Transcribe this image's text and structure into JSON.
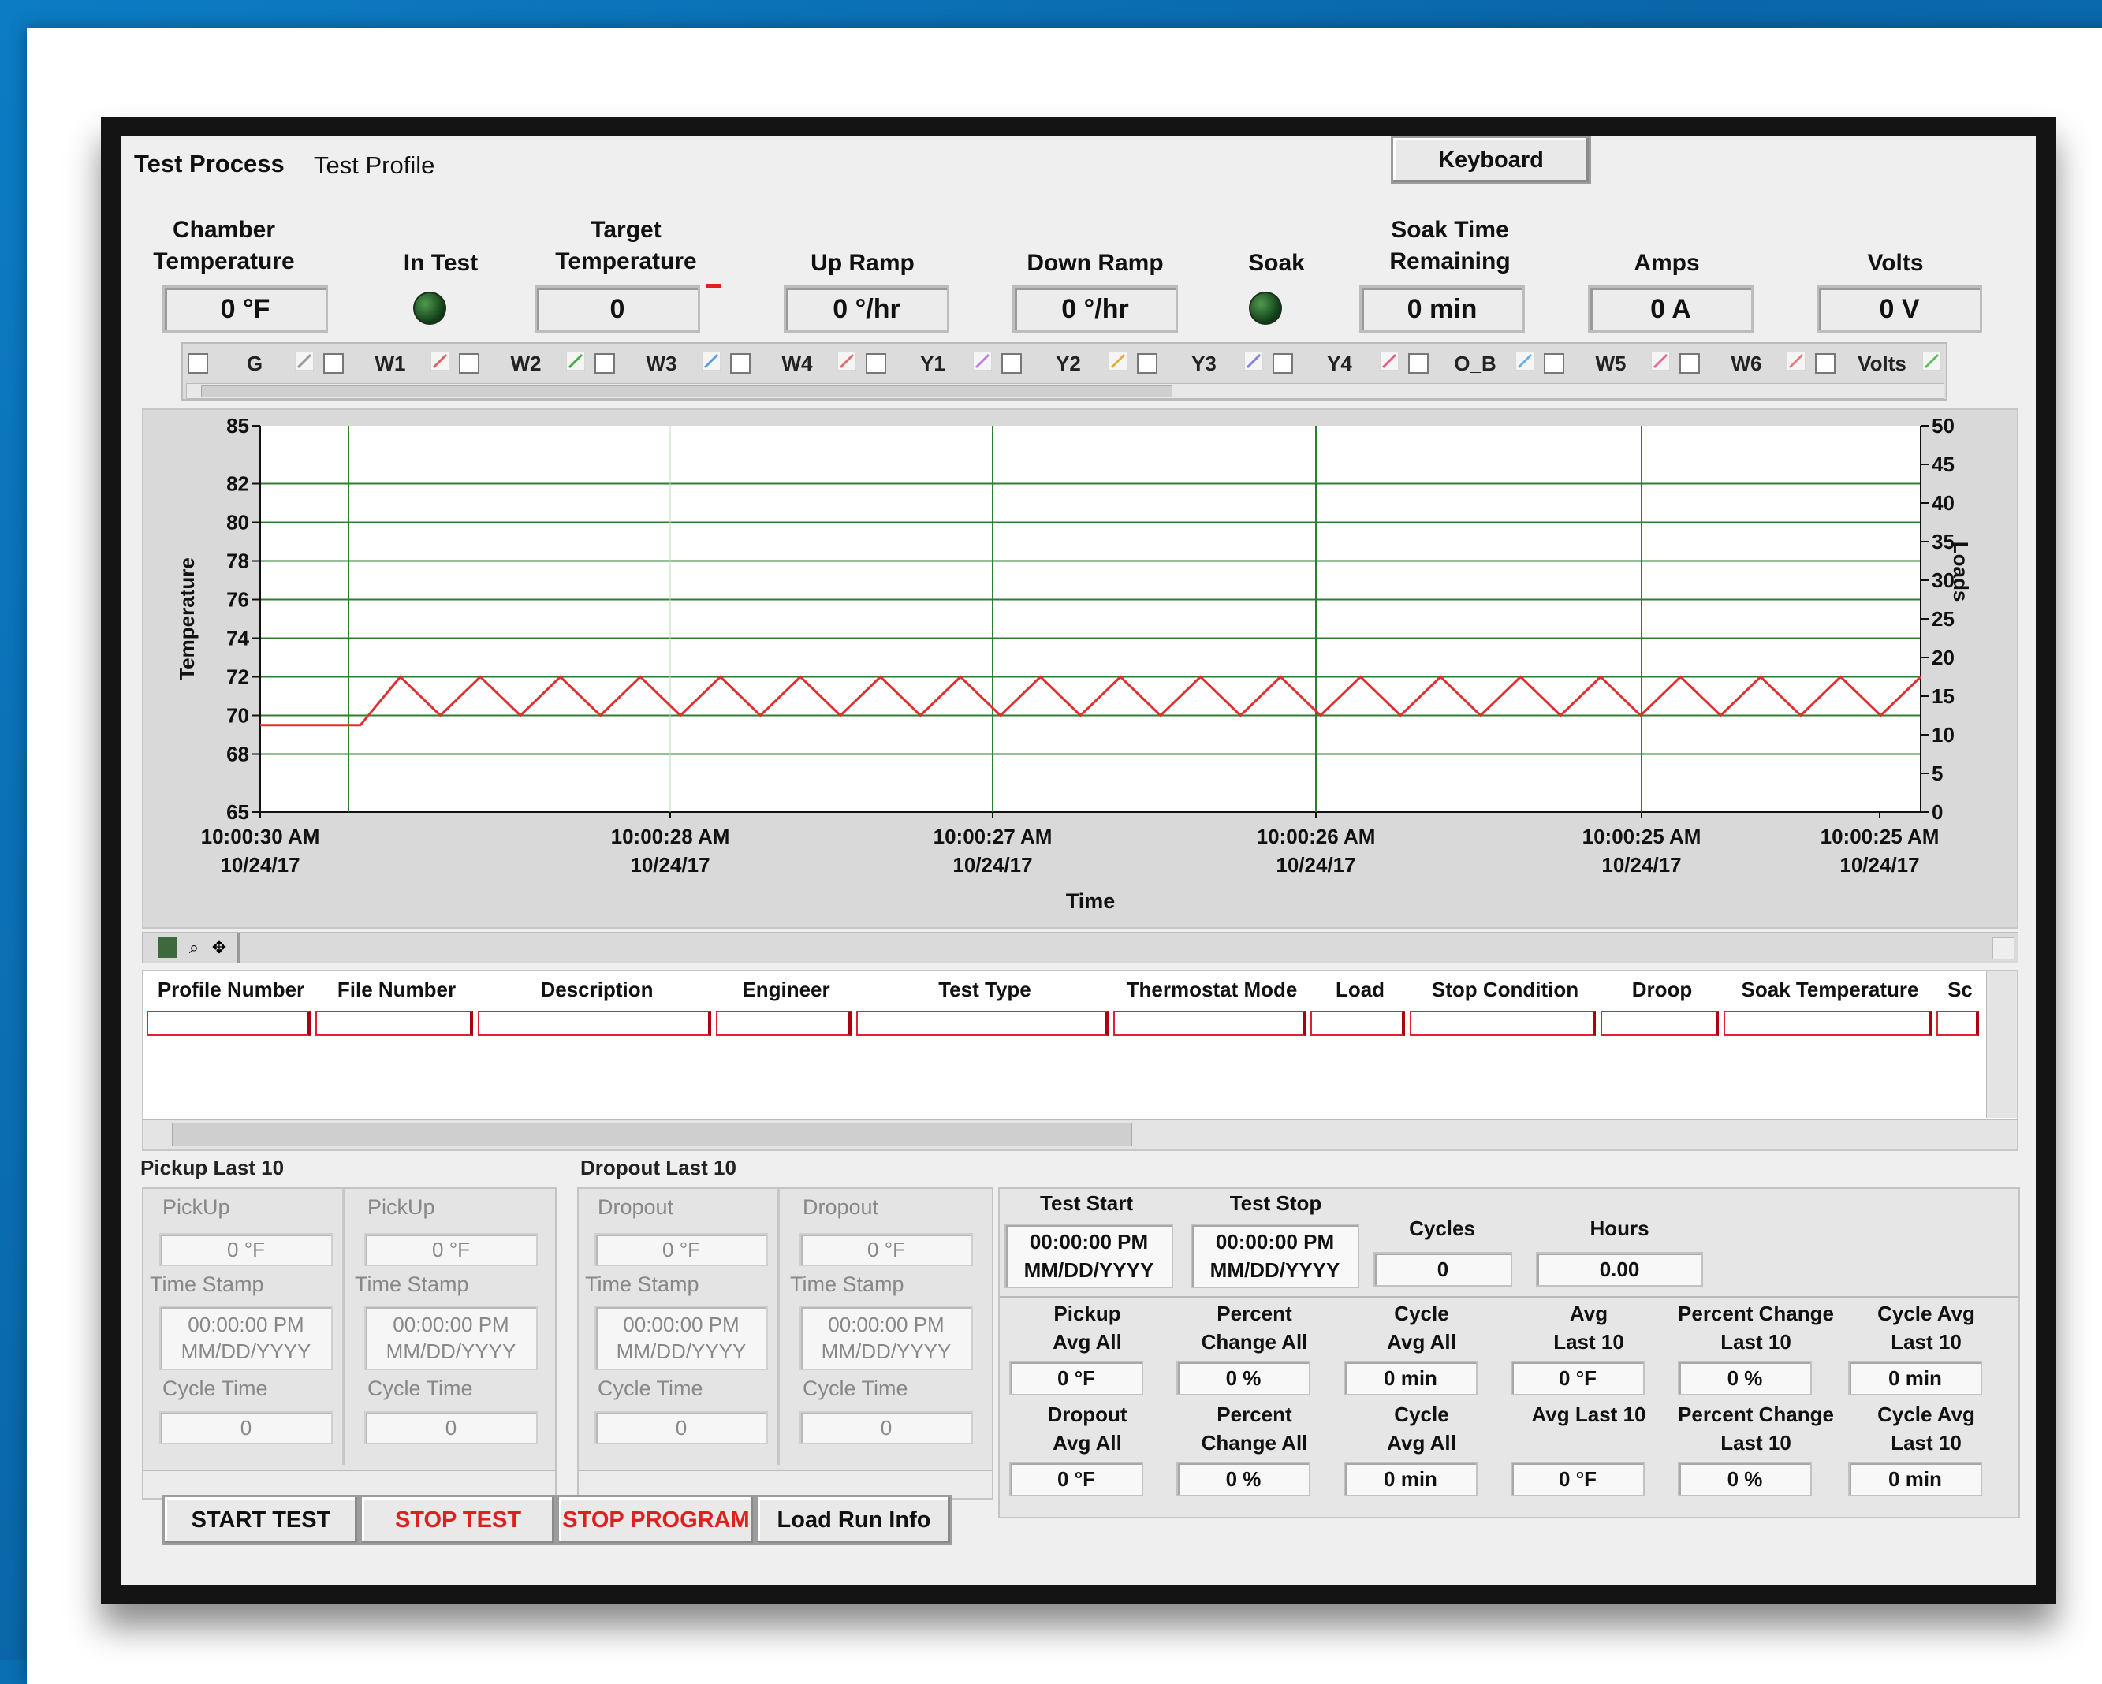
{
  "tabs": {
    "process": "Test Process",
    "profile": "Test Profile"
  },
  "keyboard_label": "Keyboard",
  "indicators": {
    "chamber_label": "Chamber\nTemperature",
    "chamber_value": "0 °F",
    "in_test_label": "In Test",
    "target_label": "Target\nTemperature",
    "target_value": "0",
    "upramp_label": "Up Ramp",
    "upramp_value": "0 °/hr",
    "downramp_label": "Down Ramp",
    "downramp_value": "0 °/hr",
    "soak_label": "Soak",
    "soaktime_label": "Soak Time\nRemaining",
    "soaktime_value": "0 min",
    "amps_label": "Amps",
    "amps_value": "0 A",
    "volts_label": "Volts",
    "volts_value": "0 V"
  },
  "channels": [
    "G",
    "W1",
    "W2",
    "W3",
    "W4",
    "Y1",
    "Y2",
    "Y3",
    "Y4",
    "O_B",
    "W5",
    "W6",
    "Volts"
  ],
  "channel_colors": [
    "#999999",
    "#e06060",
    "#40b040",
    "#5a9ee0",
    "#e07070",
    "#c080e0",
    "#e0b040",
    "#8080e0",
    "#e06080",
    "#70b0e0",
    "#e07090",
    "#e08080",
    "#60c060"
  ],
  "chart_data": {
    "type": "line",
    "xlabel": "Time",
    "ylabel": "Temperature",
    "y2label": "Loads",
    "ylim": [
      65,
      85
    ],
    "y2lim": [
      0,
      50
    ],
    "yticks": [
      "85",
      "82",
      "80",
      "78",
      "76",
      "74",
      "72",
      "70",
      "68",
      "65"
    ],
    "y2ticks": [
      "50",
      "45",
      "40",
      "35",
      "30",
      "25",
      "20",
      "15",
      "10",
      "5",
      "0"
    ],
    "xticks": [
      {
        "t": "10:00:30 AM",
        "d": "10/24/17"
      },
      {
        "t": "10:00:28 AM",
        "d": "10/24/17"
      },
      {
        "t": "10:00:27 AM",
        "d": "10/24/17"
      },
      {
        "t": "10:00:26 AM",
        "d": "10/24/17"
      },
      {
        "t": "10:00:25 AM",
        "d": "10/24/17"
      },
      {
        "t": "10:00:25 AM",
        "d": "10/24/17"
      }
    ],
    "series": [
      {
        "values": [
          69.5,
          69.5,
          69.5,
          72,
          70,
          72,
          70,
          72,
          70,
          72,
          70,
          72,
          70,
          72,
          70,
          72,
          70,
          72,
          70,
          72,
          70,
          72,
          70,
          72,
          70,
          72,
          70,
          72,
          70,
          72,
          70,
          72,
          70,
          72,
          70,
          72,
          70,
          72,
          70,
          72,
          70,
          72
        ]
      }
    ],
    "grid": true
  },
  "table": {
    "columns": [
      "Profile Number",
      "File Number",
      "Description",
      "Engineer",
      "Test Type",
      "Thermostat Mode",
      "Load",
      "Stop Condition",
      "Droop",
      "Soak Temperature",
      "Sc"
    ]
  },
  "pickup": {
    "title": "Pickup Last 10",
    "col_label": "PickUp",
    "col_label_first": "PickUp",
    "value": "0 °F",
    "ts_label": "Time Stamp",
    "ts_time": "00:00:00 PM",
    "ts_date": "MM/DD/YYYY",
    "ct_label": "Cycle Time",
    "ct_value": "0"
  },
  "dropout": {
    "title": "Dropout Last 10",
    "col_label": "Dropout",
    "value": "0 °F",
    "ts_label": "Time Stamp",
    "ts_time": "00:00:00 PM",
    "ts_date": "MM/DD/YYYY",
    "ct_label": "Cycle Time",
    "ct_value": "0"
  },
  "stats": {
    "test_start_label": "Test Start",
    "test_stop_label": "Test Stop",
    "start_time": "00:00:00 PM",
    "start_date": "MM/DD/YYYY",
    "stop_time": "00:00:00 PM",
    "stop_date": "MM/DD/YYYY",
    "cycles_label": "Cycles",
    "cycles_value": "0",
    "hours_label": "Hours",
    "hours_value": "0.00",
    "row1": [
      {
        "label": "Pickup\nAvg All",
        "value": "0 °F"
      },
      {
        "label": "Percent\nChange All",
        "value": "0 %"
      },
      {
        "label": "Cycle\nAvg All",
        "value": "0 min"
      },
      {
        "label": "Avg\nLast 10",
        "value": "0 °F"
      },
      {
        "label": "Percent Change\nLast 10",
        "value": "0 %"
      },
      {
        "label": "Cycle Avg\nLast 10",
        "value": "0 min"
      }
    ],
    "row2": [
      {
        "label": "Dropout\nAvg All",
        "value": "0 °F"
      },
      {
        "label": "Percent\nChange All",
        "value": "0 %"
      },
      {
        "label": "Cycle\nAvg All",
        "value": "0 min"
      },
      {
        "label": "Avg Last 10",
        "value": "0 °F"
      },
      {
        "label": "Percent Change\nLast 10",
        "value": "0 %"
      },
      {
        "label": "Cycle Avg\nLast 10",
        "value": "0 min"
      }
    ]
  },
  "buttons": {
    "start": "START TEST",
    "stop": "STOP TEST",
    "stop_program": "STOP PROGRAM",
    "load": "Load Run Info"
  }
}
